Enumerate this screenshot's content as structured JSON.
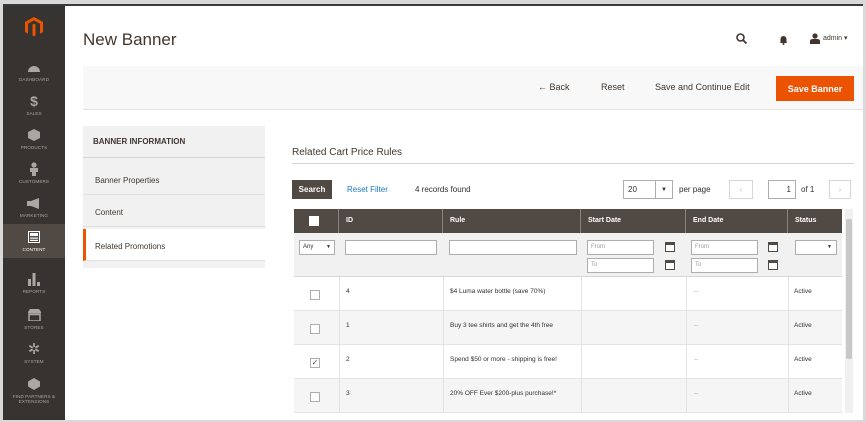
{
  "sidebar": {
    "items": [
      {
        "label": "DASHBOARD",
        "icon": "dashboard-icon"
      },
      {
        "label": "SALES",
        "icon": "dollar-icon"
      },
      {
        "label": "PRODUCTS",
        "icon": "cube-icon"
      },
      {
        "label": "CUSTOMERS",
        "icon": "person-icon"
      },
      {
        "label": "MARKETING",
        "icon": "megaphone-icon"
      },
      {
        "label": "CONTENT",
        "icon": "content-icon"
      },
      {
        "label": "REPORTS",
        "icon": "bar-chart-icon"
      },
      {
        "label": "STORES",
        "icon": "store-icon"
      },
      {
        "label": "SYSTEM",
        "icon": "gear-icon"
      },
      {
        "label": "FIND PARTNERS & EXTENSIONS",
        "icon": "puzzle-icon"
      }
    ]
  },
  "header": {
    "title": "New Banner",
    "user": "admin ▾"
  },
  "actions": {
    "back": "← Back",
    "reset": "Reset",
    "save_continue": "Save and Continue Edit",
    "save": "Save Banner"
  },
  "tabs": {
    "heading": "BANNER INFORMATION",
    "items": [
      "Banner Properties",
      "Content",
      "Related Promotions"
    ]
  },
  "section": {
    "title": "Related Cart Price Rules"
  },
  "toolbar": {
    "search": "Search",
    "reset_filter": "Reset Filter",
    "records": "4 records found",
    "per_page_value": "20",
    "per_page_label": "per page",
    "page": "1",
    "of": "of 1"
  },
  "grid": {
    "columns": [
      "ID",
      "Rule",
      "Start Date",
      "End Date",
      "Status"
    ],
    "filter": {
      "any": "Any",
      "from": "From",
      "to": "To"
    },
    "rows": [
      {
        "checked": false,
        "id": "4",
        "rule": "$4 Luma water bottle (save 70%)",
        "start": "",
        "end": "--",
        "status": "Active"
      },
      {
        "checked": false,
        "id": "1",
        "rule": "Buy 3 tee shirts and get the 4th free",
        "start": "",
        "end": "--",
        "status": "Active"
      },
      {
        "checked": true,
        "id": "2",
        "rule": "Spend $50 or more - shipping is free!",
        "start": "",
        "end": "--",
        "status": "Active"
      },
      {
        "checked": false,
        "id": "3",
        "rule": "20% OFF Ever $200-plus purchase!*",
        "start": "",
        "end": "--",
        "status": "Active"
      }
    ]
  },
  "colors": {
    "accent": "#eb5202",
    "sidebar": "#373330",
    "grid_header": "#514943",
    "link": "#1979c3"
  }
}
